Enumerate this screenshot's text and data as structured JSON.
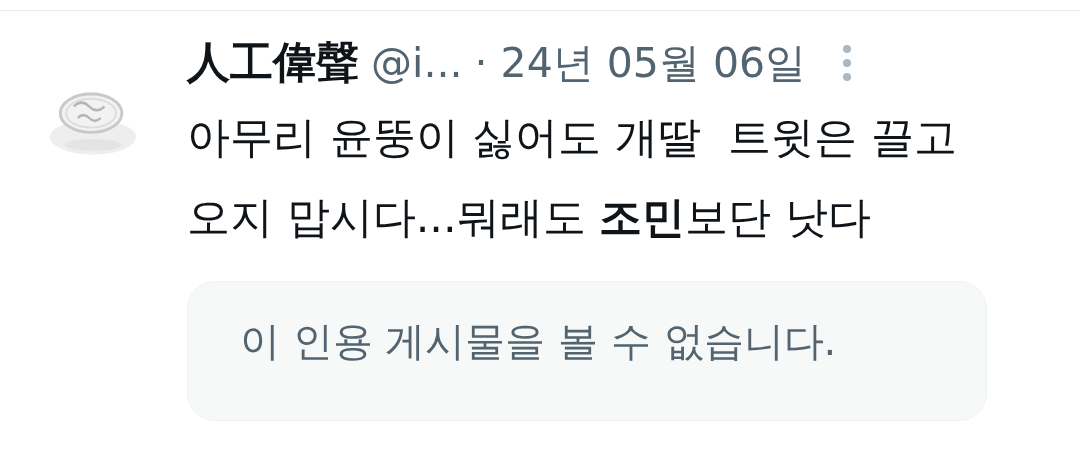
{
  "tweet": {
    "display_name": "人工偉聲",
    "handle": "@i...",
    "date": "· 24년 05월 06일",
    "text": "아무리 윤뚱이 싫어도 개딸  트윗은 끌고오지 맙시다...뭐래도 **조민**보단 낫다",
    "quote_notice": "이 인용 게시물을 볼 수 없습니다."
  }
}
